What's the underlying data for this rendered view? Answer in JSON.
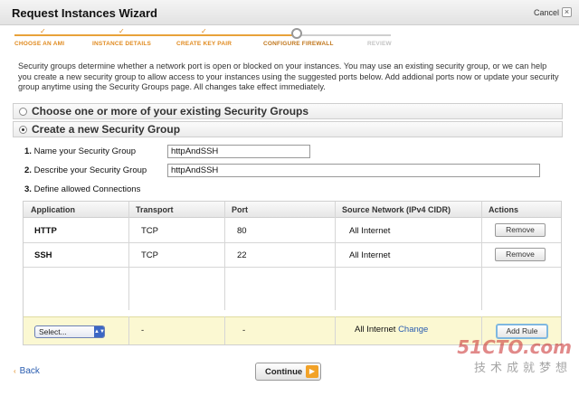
{
  "window": {
    "title": "Request Instances Wizard",
    "cancel_label": "Cancel",
    "close_glyph": "×"
  },
  "wizard_steps": [
    {
      "label": "CHOOSE AN AMI",
      "state": "done"
    },
    {
      "label": "INSTANCE DETAILS",
      "state": "done"
    },
    {
      "label": "CREATE KEY PAIR",
      "state": "done"
    },
    {
      "label": "CONFIGURE FIREWALL",
      "state": "current"
    },
    {
      "label": "REVIEW",
      "state": "future"
    }
  ],
  "check_glyph": "✓",
  "intro_text": "Security groups determine whether a network port is open or blocked on your instances. You may use an existing security group, or we can help you create a new security group to allow access to your instances using the suggested ports below. Add addional ports now or update your security group anytime using the Security Groups page. All changes take effect immediately.",
  "options": {
    "existing_label": "Choose one or more of your existing Security Groups",
    "new_label": "Create a new Security Group"
  },
  "form": {
    "name_num": "1.",
    "name_label": "Name your Security Group",
    "name_value": "httpAndSSH",
    "desc_num": "2.",
    "desc_label": "Describe your Security Group",
    "desc_value": "httpAndSSH",
    "conn_num": "3.",
    "conn_label": "Define allowed Connections"
  },
  "table": {
    "headers": [
      "Application",
      "Transport",
      "Port",
      "Source Network (IPv4 CIDR)",
      "Actions"
    ],
    "rows": [
      {
        "application": "HTTP",
        "transport": "TCP",
        "port": "80",
        "source": "All Internet",
        "action": "Remove"
      },
      {
        "application": "SSH",
        "transport": "TCP",
        "port": "22",
        "source": "All Internet",
        "action": "Remove"
      }
    ],
    "add_row": {
      "select_value": "Select...",
      "transport": "-",
      "port": "-",
      "source": "All Internet",
      "change_label": "Change",
      "add_rule_label": "Add Rule"
    }
  },
  "footer": {
    "back_label": "Back",
    "back_arrow": "‹",
    "continue_label": "Continue",
    "continue_arrow": "▶"
  },
  "watermark": {
    "main": "51CTO.com",
    "sub": "技术成就梦想"
  }
}
